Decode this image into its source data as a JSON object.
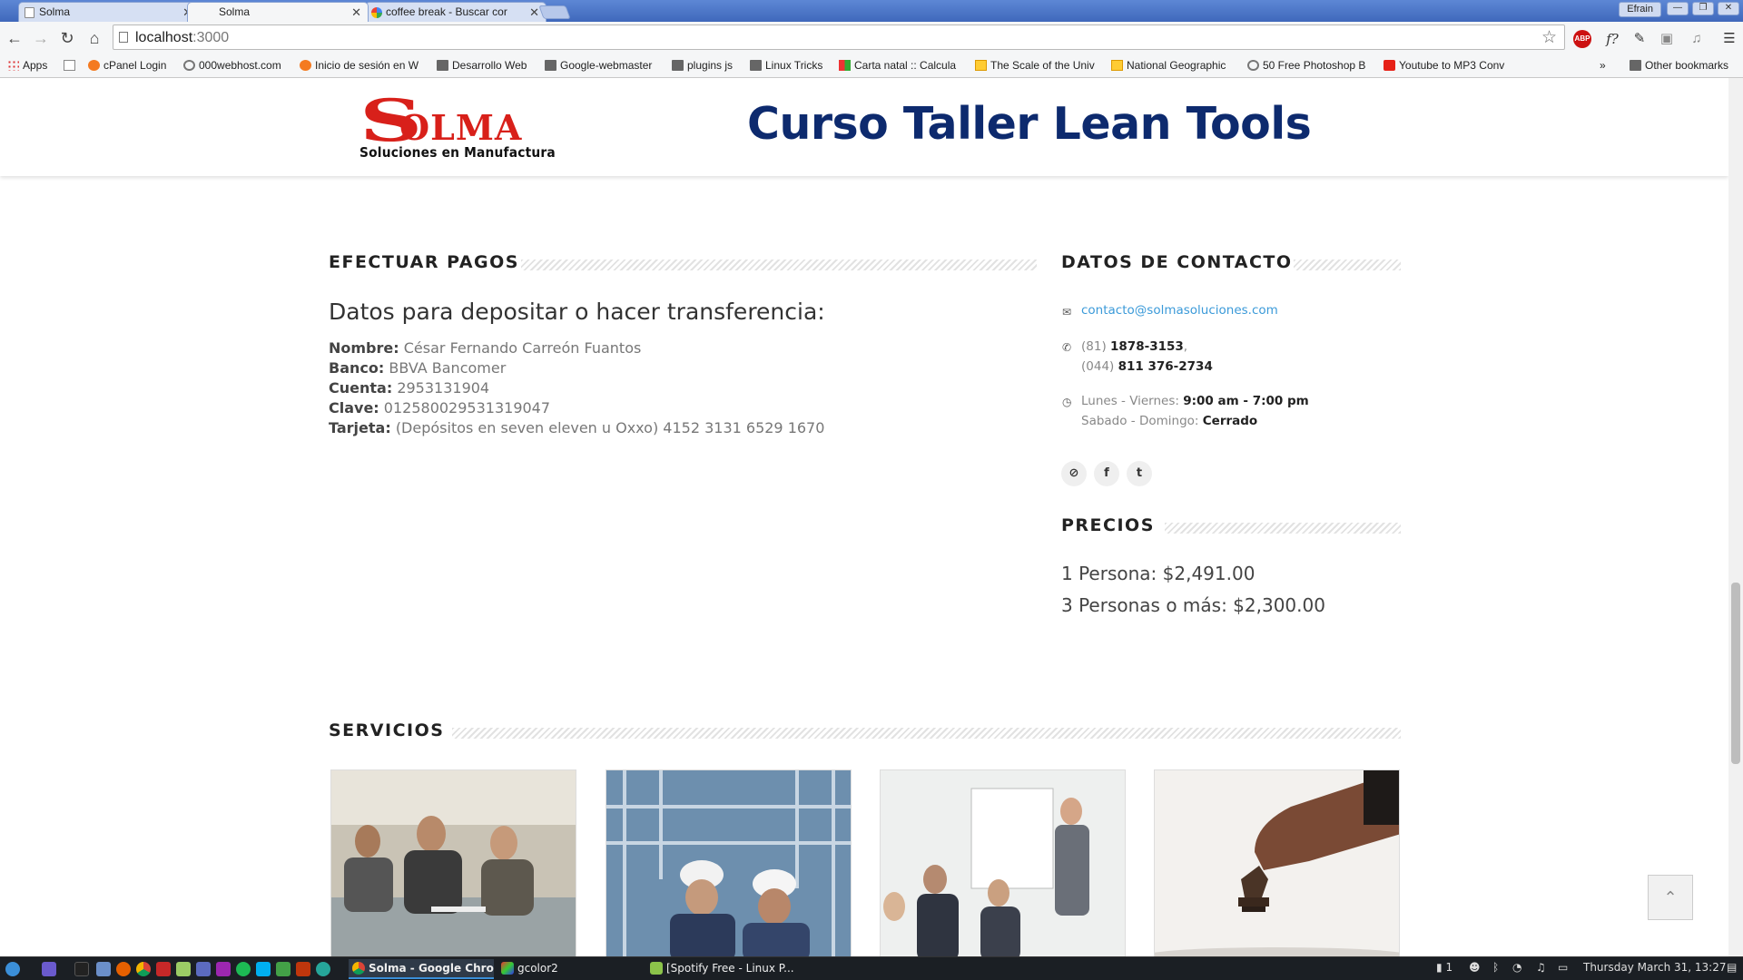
{
  "browser": {
    "tabs": [
      {
        "title": "Solma",
        "active": false
      },
      {
        "title": "Solma",
        "active": true
      },
      {
        "title": "coffee break - Buscar cor",
        "active": false
      }
    ],
    "user": "Efrain",
    "url_host": "localhost",
    "url_port": ":3000"
  },
  "bookmarks": [
    {
      "label": "Apps",
      "icon": "apps"
    },
    {
      "label": "",
      "icon": "doc"
    },
    {
      "label": "cPanel Login",
      "icon": "cp"
    },
    {
      "label": "000webhost.com",
      "icon": "ring"
    },
    {
      "label": "Inicio de sesión en W",
      "icon": "cp"
    },
    {
      "label": "Desarrollo Web",
      "icon": "folder"
    },
    {
      "label": "Google-webmaster",
      "icon": "folder"
    },
    {
      "label": "plugins js",
      "icon": "folder"
    },
    {
      "label": "Linux Tricks",
      "icon": "folder"
    },
    {
      "label": "Carta natal :: Calcula",
      "icon": "grid"
    },
    {
      "label": "The Scale of the Univ",
      "icon": "yel"
    },
    {
      "label": "National Geographic",
      "icon": "yel"
    },
    {
      "label": "50 Free Photoshop B",
      "icon": "ring"
    },
    {
      "label": "Youtube to MP3 Conv",
      "icon": "yt"
    }
  ],
  "bookmarks_overflow": "»",
  "other_bookmarks": "Other bookmarks",
  "site": {
    "logo_text": "OLMA",
    "logo_initial": "S",
    "logo_tagline": "Soluciones en Manufactura",
    "title": "Curso Taller Lean Tools"
  },
  "payments": {
    "heading": "EFECTUAR PAGOS",
    "subtitle": "Datos para depositar o hacer transferencia:",
    "rows": [
      {
        "label": "Nombre:",
        "value": "César Fernando Carreón Fuantos"
      },
      {
        "label": "Banco:",
        "value": "BBVA Bancomer"
      },
      {
        "label": "Cuenta:",
        "value": "2953131904"
      },
      {
        "label": "Clave:",
        "value": "012580029531319047"
      },
      {
        "label": "Tarjeta:",
        "value": "(Depósitos en seven eleven u Oxxo) 4152 3131 6529 1670"
      }
    ]
  },
  "contact": {
    "heading": "DATOS DE CONTACTO",
    "email": "contacto@solmasoluciones.com",
    "phone1_prefix": "(81)",
    "phone1": "1878-3153",
    "phone1_suffix": ",",
    "phone2_prefix": "(044)",
    "phone2": "811 376-2734",
    "hours1_label": "Lunes - Viernes:",
    "hours1": "9:00 am - 7:00 pm",
    "hours2_label": "Sabado - Domingo:",
    "hours2": "Cerrado"
  },
  "prices": {
    "heading": "PRECIOS",
    "items": [
      "1 Persona: $2,491.00",
      "3 Personas o más: $2,300.00"
    ]
  },
  "services": {
    "heading": "SERVICIOS"
  },
  "taskbar": {
    "windows": [
      {
        "title": "Solma - Google Chro...",
        "active": true
      },
      {
        "title": "gcolor2",
        "active": false
      },
      {
        "title": "[Spotify Free - Linux P...",
        "active": false
      }
    ],
    "notifications": "1",
    "clock": "Thursday March 31, 13:27"
  },
  "colors": {
    "brand_red": "#d8201a",
    "title_blue": "#0d2a6e",
    "link_blue": "#3b9ad9"
  }
}
